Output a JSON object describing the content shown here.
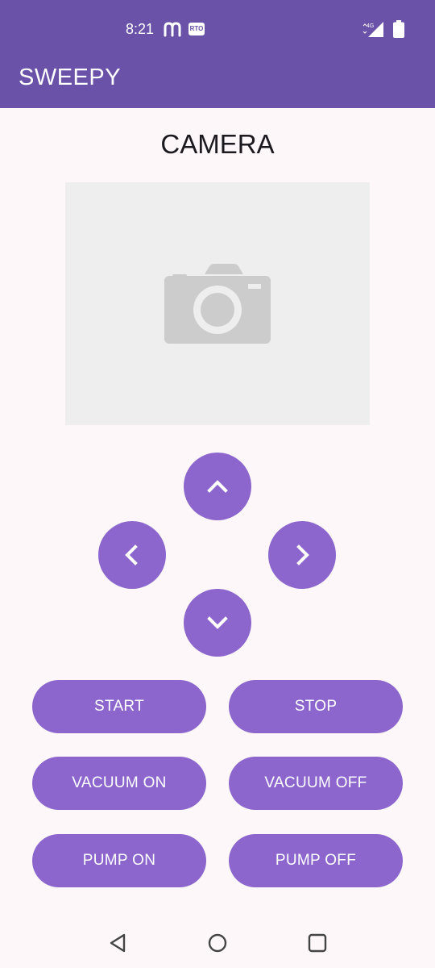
{
  "status_bar": {
    "time": "8:21",
    "rto_badge": "RTO",
    "network_label": "4G",
    "icons": [
      "m-icon",
      "rto-icon",
      "signal-icon",
      "battery-icon"
    ]
  },
  "app_bar": {
    "title": "SWEEPY"
  },
  "camera": {
    "heading": "CAMERA",
    "placeholder_icon": "camera-icon"
  },
  "dpad": {
    "up_icon": "chevron-up-icon",
    "left_icon": "chevron-left-icon",
    "right_icon": "chevron-right-icon",
    "down_icon": "chevron-down-icon"
  },
  "controls": {
    "start_label": "START",
    "stop_label": "STOP",
    "vacuum_on_label": "VACUUM ON",
    "vacuum_off_label": "VACUUM OFF",
    "pump_on_label": "PUMP ON",
    "pump_off_label": "PUMP OFF"
  },
  "nav_bar": {
    "icons": [
      "back-icon",
      "home-icon",
      "recents-icon"
    ]
  },
  "colors": {
    "primary_dark": "#6a52a8",
    "button": "#8c66cc",
    "background": "#fdf7fa",
    "camera_bg": "#eeeeee",
    "camera_icon": "#cccccc"
  }
}
